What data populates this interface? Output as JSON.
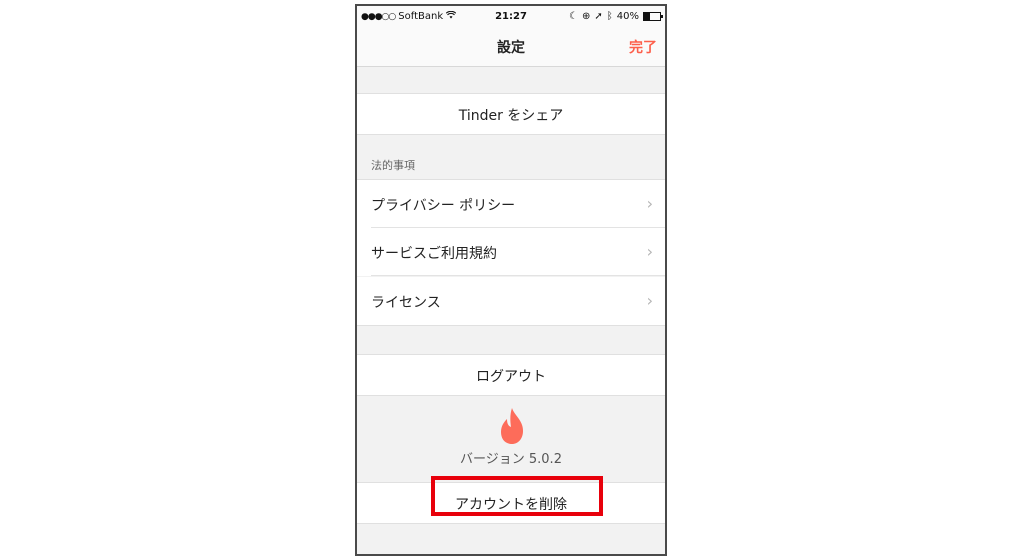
{
  "status_bar": {
    "signal": "●●●○○",
    "carrier": "SoftBank",
    "time": "21:27",
    "battery_percent": "40%"
  },
  "nav": {
    "title": "設定",
    "done_label": "完了",
    "done_color": "#fd5f4b"
  },
  "share": {
    "label": "Tinder をシェア"
  },
  "legal": {
    "header": "法的事項",
    "items": [
      {
        "label": "プライバシー ポリシー"
      },
      {
        "label": "サービスご利用規約"
      },
      {
        "label": "ライセンス"
      }
    ]
  },
  "logout": {
    "label": "ログアウト"
  },
  "footer": {
    "logo_icon": "tinder-flame-icon",
    "version": "バージョン 5.0.2"
  },
  "delete_account": {
    "label": "アカウントを削除"
  },
  "highlight_color": "#e8000b"
}
